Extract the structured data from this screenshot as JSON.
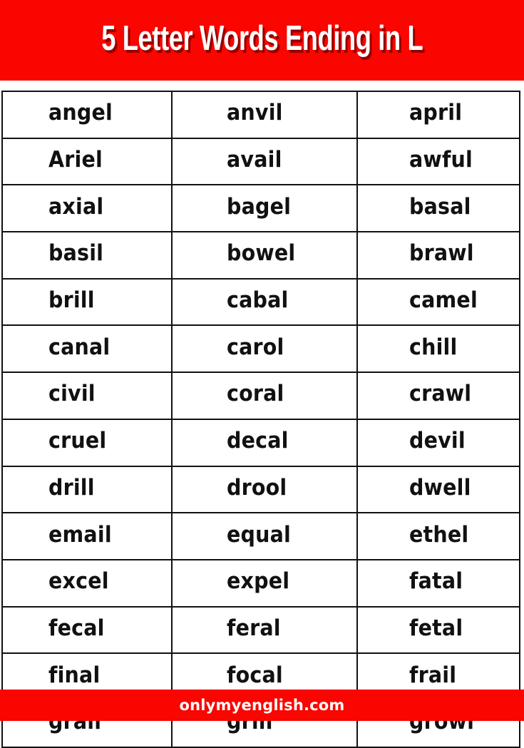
{
  "header": {
    "title": "5 Letter Words Ending in L",
    "background_color": "#fa0500",
    "text_color": "#ffffff"
  },
  "table": {
    "columns": 3,
    "rows": [
      [
        "angel",
        "anvil",
        "april"
      ],
      [
        "Ariel",
        "avail",
        "awful"
      ],
      [
        "axial",
        "bagel",
        "basal"
      ],
      [
        "basil",
        "bowel",
        "brawl"
      ],
      [
        "brill",
        "cabal",
        "camel"
      ],
      [
        "canal",
        "carol",
        "chill"
      ],
      [
        "civil",
        "coral",
        "crawl"
      ],
      [
        "cruel",
        "decal",
        "devil"
      ],
      [
        "drill",
        "drool",
        "dwell"
      ],
      [
        "email",
        "equal",
        "ethel"
      ],
      [
        "excel",
        "expel",
        "fatal"
      ],
      [
        "fecal",
        "feral",
        "fetal"
      ],
      [
        "final",
        "focal",
        "frail"
      ],
      [
        "grail",
        "grill",
        "growl"
      ]
    ],
    "border_color": "#111111",
    "cell_background": "#ffffff",
    "text_color": "#111111"
  },
  "footer": {
    "site": "onlymyenglish.com",
    "background_color": "#fa0500",
    "text_color": "#ffffff"
  }
}
